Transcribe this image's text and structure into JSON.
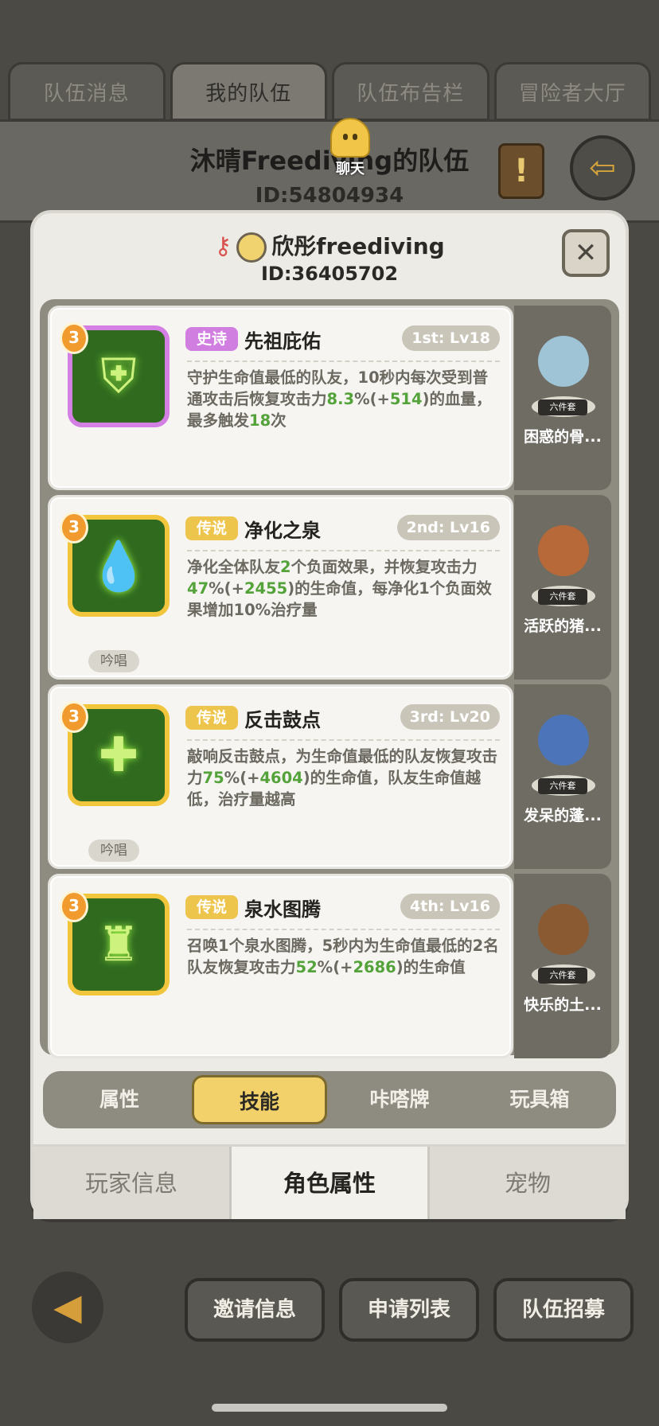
{
  "header": {
    "tabs": [
      {
        "label": "队伍消息"
      },
      {
        "label": "我的队伍"
      },
      {
        "label": "队伍布告栏"
      },
      {
        "label": "冒险者大厅"
      }
    ],
    "team_name": "沐晴Freediving的队伍",
    "team_id": "ID:54804934",
    "chat_label": "聊天",
    "scroll_glyph": "!"
  },
  "panel": {
    "player_name": "欣彤freediving",
    "player_id": "ID:36405702",
    "close_symbol": "✕",
    "skills": [
      {
        "level_badge": "3",
        "rarity": "史诗",
        "rarity_color": "#d07ee0",
        "name": "先祖庇佑",
        "rank": "1st: Lv18",
        "desc_parts": [
          "守护生命值最低的队友，10秒内每次受到普通攻击后恢复攻击力",
          "8.3",
          "%(+",
          "514",
          ")的血量，最多触发",
          "18",
          "次"
        ],
        "icon": "shield-icon",
        "companion": "困惑的骨...",
        "companion_tag": "六件套"
      },
      {
        "level_badge": "3",
        "rarity": "传说",
        "rarity_color": "#eec54c",
        "name": "净化之泉",
        "rank": "2nd: Lv16",
        "desc_parts": [
          "净化全体队友",
          "2",
          "个负面效果，并恢复攻击力",
          "47",
          "%(+",
          "2455",
          ")的生命值，每净化1个负面效果增加10%治疗量"
        ],
        "icon": "droplet-icon",
        "chant": "吟唱",
        "companion": "活跃的猪...",
        "companion_tag": "六件套"
      },
      {
        "level_badge": "3",
        "rarity": "传说",
        "rarity_color": "#eec54c",
        "name": "反击鼓点",
        "rank": "3rd: Lv20",
        "desc_parts": [
          "敲响反击鼓点，为生命值最低的队友恢复攻击力",
          "75",
          "%(+",
          "4604",
          ")的生命值，队友生命值越低，治疗量越高"
        ],
        "icon": "drum-cross-icon",
        "chant": "吟唱",
        "companion": "发呆的蓬...",
        "companion_tag": "六件套"
      },
      {
        "level_badge": "3",
        "rarity": "传说",
        "rarity_color": "#eec54c",
        "name": "泉水图腾",
        "rank": "4th: Lv16",
        "desc_parts": [
          "召唤1个泉水图腾，5秒内为生命值最低的2名队友恢复攻击力",
          "52",
          "%(+",
          "2686",
          ")的生命值"
        ],
        "icon": "totem-icon",
        "companion": "快乐的土...",
        "companion_tag": "六件套"
      }
    ],
    "subtabs": [
      {
        "label": "属性"
      },
      {
        "label": "技能"
      },
      {
        "label": "咔嗒牌"
      },
      {
        "label": "玩具箱"
      }
    ],
    "bottom_tabs": [
      {
        "label": "玩家信息"
      },
      {
        "label": "角色属性"
      },
      {
        "label": "宠物"
      }
    ]
  },
  "footer": {
    "back_symbol": "◀",
    "buttons": [
      {
        "label": "邀请信息"
      },
      {
        "label": "申请列表"
      },
      {
        "label": "队伍招募"
      }
    ]
  }
}
